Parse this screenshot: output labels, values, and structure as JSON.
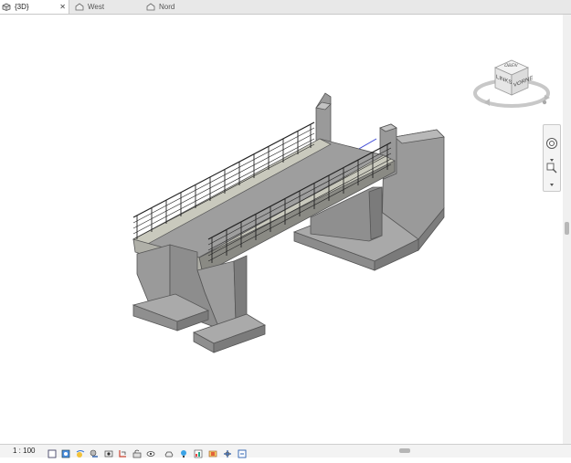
{
  "tabs": [
    {
      "label": "{3D}",
      "active": true,
      "closable": true
    },
    {
      "label": "West",
      "active": false
    },
    {
      "label": "Nord",
      "active": false
    }
  ],
  "viewcube": {
    "top_label": "OBEN",
    "left_label": "LINKS",
    "right_label": "VORNE"
  },
  "status": {
    "scale": "1 : 100"
  },
  "icons": {
    "tab_view": "3d-view-icon",
    "tab_elevation": "elevation-icon",
    "nav_wheel": "steering-wheel-icon",
    "nav_zoom": "zoom-icon",
    "status": [
      "detail-level-icon",
      "visual-style-icon",
      "sun-path-icon",
      "shadows-icon",
      "crop-view-icon",
      "show-crop-icon",
      "unlock-3d-icon",
      "temporary-hide-icon",
      "reveal-hidden-icon",
      "worksharing-icon",
      "analysis-icon",
      "highlight-displacement-icon",
      "constraints-icon"
    ]
  },
  "colors": {
    "accent": "#2f6bd8",
    "concrete": "#8a8a8a",
    "deck": "#c9c9bd"
  }
}
